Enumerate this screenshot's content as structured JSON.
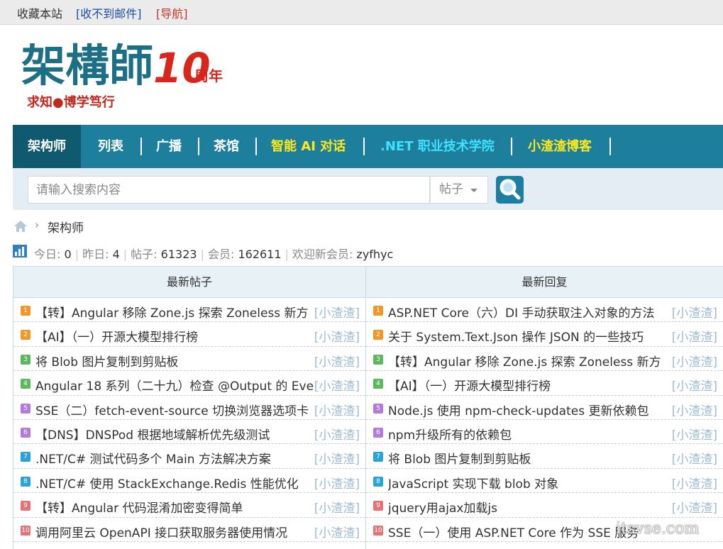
{
  "topbar": {
    "bookmark": "收藏本站",
    "mail_link": "[收不到邮件]",
    "nav_link": "[导航]"
  },
  "logo": {
    "name": "架構師",
    "anniversary_number": "10",
    "anniversary_suffix": "周年",
    "slogan": "求知●博学笃行"
  },
  "nav": {
    "items": [
      {
        "label": "架构师",
        "active": true
      },
      {
        "label": "列表"
      },
      {
        "label": "广播"
      },
      {
        "label": "茶馆"
      },
      {
        "label": "智能 AI 对话"
      },
      {
        "label": ".NET 职业技术学院"
      },
      {
        "label": "小渣渣博客"
      }
    ]
  },
  "search": {
    "placeholder": "请输入搜索内容",
    "scope": "帖子",
    "button_icon": "search-icon"
  },
  "breadcrumb": {
    "home_icon": "home-icon",
    "current": "架构师"
  },
  "stats": {
    "today_label": "今日:",
    "today": "0",
    "yesterday_label": "昨日:",
    "yesterday": "4",
    "posts_label": "帖子:",
    "posts": "61323",
    "members_label": "会员:",
    "members": "162611",
    "newest_label": "欢迎新会员:",
    "newest": "zyfhyc"
  },
  "latest_posts": {
    "header": "最新帖子",
    "rows": [
      {
        "n": "1",
        "title": "【转】Angular 移除 Zone.js 探索 Zoneless 新方",
        "author": "[小渣渣]"
      },
      {
        "n": "2",
        "title": "【AI】（一）开源大模型排行榜",
        "author": "[小渣渣]"
      },
      {
        "n": "3",
        "title": "将 Blob 图片复制到剪贴板",
        "author": "[小渣渣]"
      },
      {
        "n": "4",
        "title": "Angular 18 系列（二十九）检查 @Output 的 Eve",
        "author": "[小渣渣]"
      },
      {
        "n": "5",
        "title": "SSE（二）fetch-event-source 切换浏览器选项卡",
        "author": "[小渣渣]"
      },
      {
        "n": "6",
        "title": "【DNS】DNSPod 根据地域解析优先级测试",
        "author": "[小渣渣]"
      },
      {
        "n": "7",
        "title": ".NET/C# 测试代码多个 Main 方法解决方案",
        "author": "[小渣渣]"
      },
      {
        "n": "8",
        "title": ".NET/C# 使用 StackExchange.Redis 性能优化",
        "author": "[小渣渣]"
      },
      {
        "n": "9",
        "title": "【转】Angular 代码混淆加密变得简单",
        "author": "[小渣渣]"
      },
      {
        "n": "10",
        "title": "调用阿里云 OpenAPI 接口获取服务器使用情况",
        "author": "[小渣渣]"
      }
    ]
  },
  "latest_replies": {
    "header": "最新回复",
    "rows": [
      {
        "n": "1",
        "title": "ASP.NET Core（六）DI 手动获取注入对象的方法",
        "author": "[小渣渣]"
      },
      {
        "n": "2",
        "title": "关于 System.Text.Json 操作 JSON 的一些技巧",
        "author": "[小渣渣]"
      },
      {
        "n": "3",
        "title": "【转】Angular 移除 Zone.js 探索 Zoneless 新方",
        "author": "[小渣渣]"
      },
      {
        "n": "4",
        "title": "【AI】（一）开源大模型排行榜",
        "author": "[小渣渣]"
      },
      {
        "n": "5",
        "title": "Node.js 使用 npm-check-updates 更新依赖包",
        "author": "[小渣渣]"
      },
      {
        "n": "6",
        "title": "npm升级所有的依赖包",
        "author": "[小渣渣]"
      },
      {
        "n": "7",
        "title": "将 Blob 图片复制到剪贴板",
        "author": "[小渣渣]"
      },
      {
        "n": "8",
        "title": "JavaScript 实现下载 blob 对象",
        "author": "[小渣渣]"
      },
      {
        "n": "9",
        "title": "jquery用ajax加载js",
        "author": "[小渣渣]"
      },
      {
        "n": "10",
        "title": "SSE（一）使用 ASP.NET Core 作为 SSE 服务",
        "author": ""
      }
    ]
  },
  "watermark": "itsvse.com",
  "colors": {
    "nav_bg": "#1d7f9b",
    "nav_active": "#0f5a6f",
    "nav_yellow": "#ffe81a",
    "nav_cyan": "#3fe1ff",
    "rank": [
      "#f29727",
      "#f29727",
      "#5cb85c",
      "#5cb85c",
      "#b47ae0",
      "#b47ae0",
      "#2aa3d8",
      "#2aa3d8",
      "#e57373",
      "#e57373"
    ]
  }
}
